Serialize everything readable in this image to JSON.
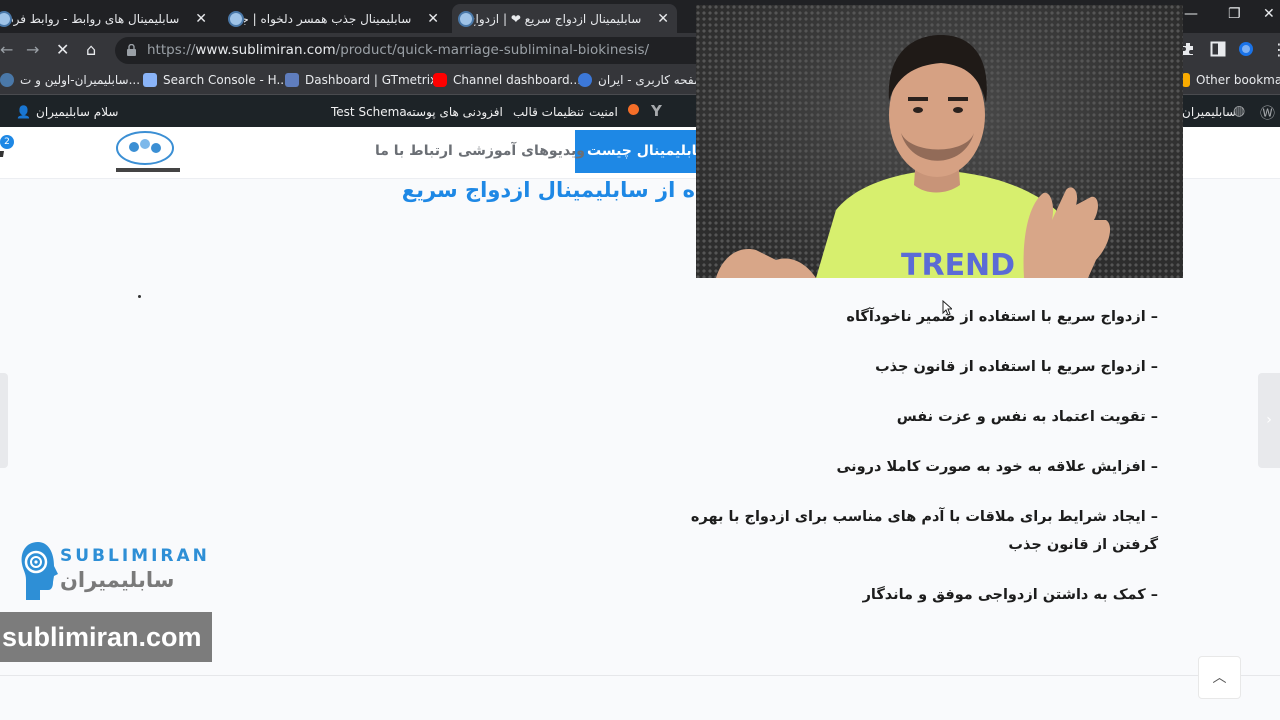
{
  "browser": {
    "tabs": [
      {
        "label": "سابلیمینال های روابط - روابط فردی"
      },
      {
        "label": "سابلیمینال جذب همسر دلخواه | جذ"
      },
      {
        "label": "سابلیمینال ازدواج سریع ❤ | ازدواج",
        "active": true
      }
    ],
    "url_prefix": "https://",
    "url_host": "www.sublimiran.com",
    "url_path": "/product/quick-marriage-subliminal-biokinesis/"
  },
  "bookmarks": [
    {
      "label": "سابلیمیران-اولین و ت...",
      "color": "#4a78a8"
    },
    {
      "label": "Search Console - H...",
      "color": "#8ab4f8"
    },
    {
      "label": "Dashboard | GTmetrix",
      "color": "#5f7dbd"
    },
    {
      "label": "Channel dashboard...",
      "color": "#ff0000"
    },
    {
      "label": "صفحه کاربری - ایران...",
      "color": "#3c78d8"
    },
    {
      "label": "Other bookmark",
      "color": "#f9ab00"
    }
  ],
  "adminbar": {
    "greeting": "سلام سابلیمیران",
    "test_schema": "Test Schema",
    "addons": "افزودنی های پوسته",
    "theme_settings": "تنظیمات قالب",
    "security": "امنیت",
    "site_name": "سابلیمیران"
  },
  "nav": {
    "what_is": "سابلیمینال چیست",
    "videos": "ویدیوهای آموزشی",
    "contact": "ارتباط با ما",
    "cart_count": "2"
  },
  "content": {
    "heading": "ه از سابلیمینال ازدواج سریع",
    "bullets": [
      "– ازدواج سریع با استفاده از ضمیر ناخودآگاه",
      "– ازدواج سریع با استفاده از قانون جذب",
      "– تقویت اعتماد به نفس و عزت نفس",
      "– افزایش علاقه به خود به صورت کاملا درونی",
      "– ایجاد شرایط برای ملاقات با آدم های مناسب برای ازدواج با بهره گرفتن از قانون جذب",
      "– کمک به داشتن ازدواجی موفق و ماندگار"
    ]
  },
  "brand": {
    "en": "SUBLIMIRAN",
    "fa": "سابلیمیران",
    "watermark": "sublimiran.com"
  },
  "video": {
    "shirt_text": "TREND"
  },
  "colors": {
    "accent": "#1e88e5",
    "chrome_dark": "#202124",
    "admin_bar": "#1d2327"
  }
}
